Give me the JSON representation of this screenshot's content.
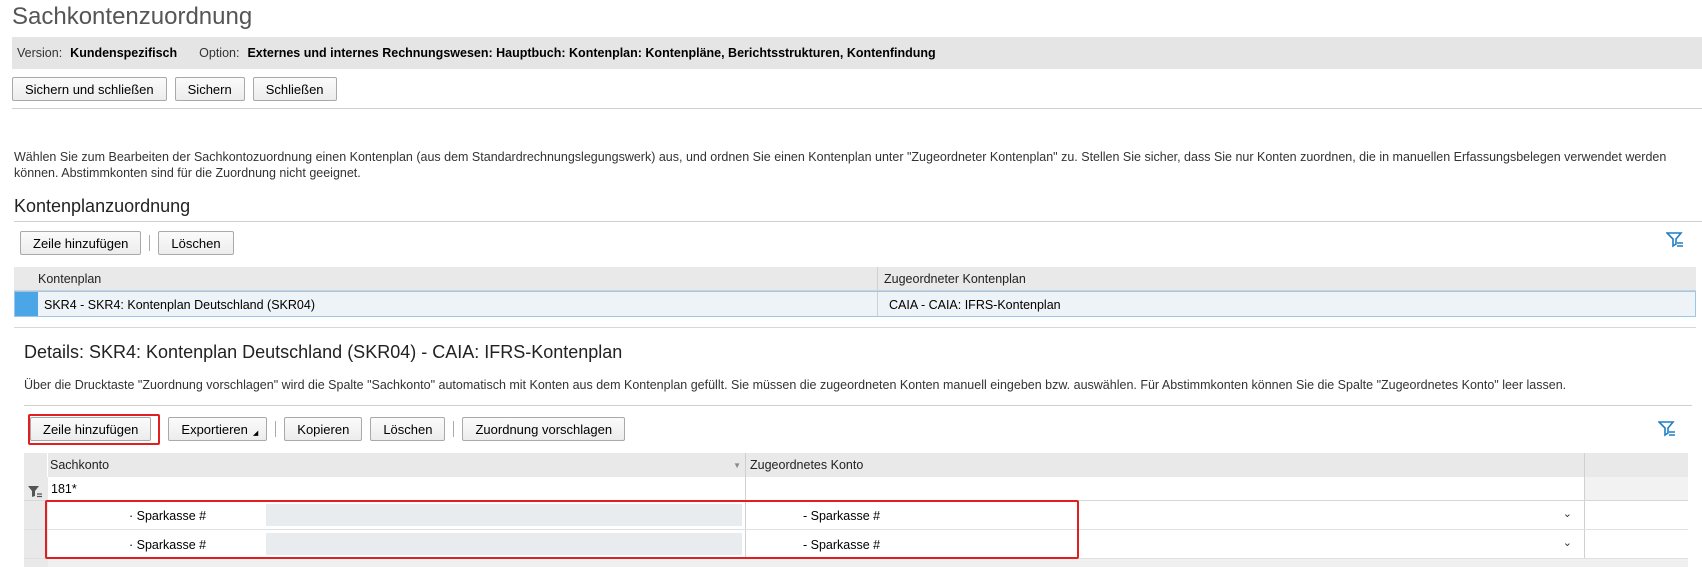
{
  "page": {
    "title": "Sachkontenzuordnung"
  },
  "infobar": {
    "version_label": "Version:",
    "version_value": "Kundenspezifisch",
    "option_label": "Option:",
    "option_value": "Externes und internes Rechnungswesen: Hauptbuch: Kontenplan: Kontenpläne, Berichtsstrukturen, Kontenfindung"
  },
  "toolbar": {
    "save_close_label": "Sichern und schließen",
    "save_label": "Sichern",
    "close_label": "Schließen"
  },
  "description": "Wählen Sie zum Bearbeiten der Sachkontozuordnung einen Kontenplan (aus dem Standardrechnungslegungswerk) aus, und ordnen Sie einen Kontenplan unter \"Zugeordneter Kontenplan\" zu. Stellen Sie sicher, dass Sie nur Konten zuordnen, die in manuellen Erfassungsbelegen verwendet werden können. Abstimmkonten sind für die Zuordnung nicht geeignet.",
  "kontenplan_section": {
    "title": "Kontenplanzuordnung",
    "add_row_label": "Zeile hinzufügen",
    "delete_label": "Löschen",
    "columns": [
      "Kontenplan",
      "Zugeordneter Kontenplan"
    ],
    "rows": [
      {
        "kontenplan": "SKR4 - SKR4: Kontenplan Deutschland (SKR04)",
        "zugeordnet": "CAIA - CAIA: IFRS-Kontenplan"
      }
    ]
  },
  "details": {
    "title": "Details: SKR4: Kontenplan Deutschland (SKR04) - CAIA: IFRS-Kontenplan",
    "description": "Über die Drucktaste \"Zuordnung vorschlagen\" wird die Spalte \"Sachkonto\" automatisch mit Konten aus dem Kontenplan gefüllt. Sie müssen die zugeordneten Konten manuell eingeben bzw. auswählen. Für Abstimmkonten können Sie die Spalte \"Zugeordnetes Konto\" leer lassen.",
    "toolbar": {
      "add_row_label": "Zeile hinzufügen",
      "export_label": "Exportieren",
      "copy_label": "Kopieren",
      "delete_label": "Löschen",
      "suggest_label": "Zuordnung vorschlagen"
    },
    "columns": [
      "Sachkonto",
      "Zugeordnetes Konto"
    ],
    "filter_value": "181*",
    "rows": [
      {
        "sachkonto": "· Sparkasse #",
        "zugeordnet": "- Sparkasse #"
      },
      {
        "sachkonto": "· Sparkasse #",
        "zugeordnet": "- Sparkasse #"
      }
    ]
  },
  "icons": {
    "filter": "filter-icon",
    "sort": "sort-indicator-icon",
    "dropdown": "chevron-down-icon",
    "menu_arrow": "menu-arrow-icon"
  },
  "colors": {
    "selection": "#4aa6e6",
    "highlight": "#e02020",
    "filter_icon": "#1f7fc4"
  }
}
